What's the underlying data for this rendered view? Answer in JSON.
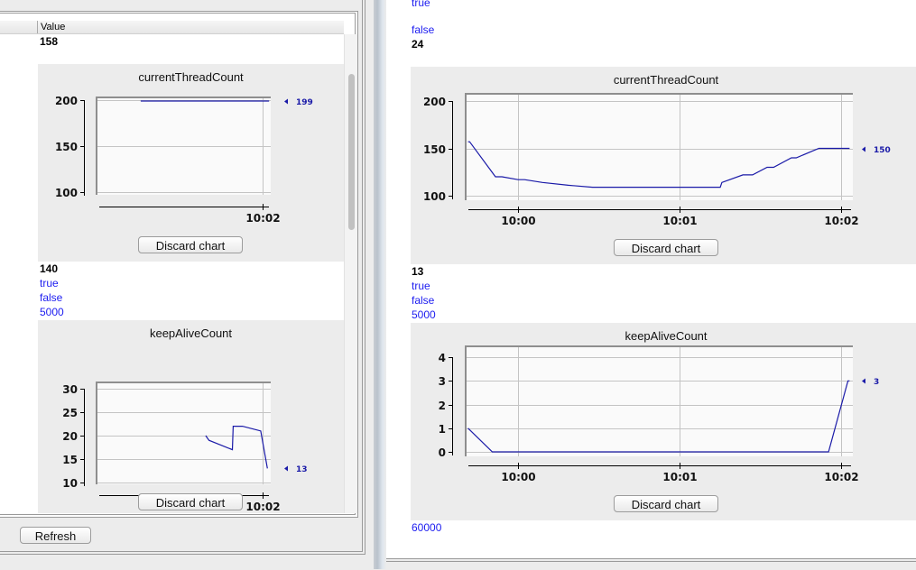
{
  "left_panel": {
    "table_header": {
      "value_column": "Value"
    },
    "rows_top": [
      {
        "text": "158",
        "style": "black"
      }
    ],
    "chart1": {
      "title": "currentThreadCount",
      "discard_label": "Discard chart",
      "last_value_label": "199"
    },
    "rows_mid": [
      {
        "text": "140",
        "style": "black"
      },
      {
        "text": "true",
        "style": "blue"
      },
      {
        "text": "false",
        "style": "blue"
      },
      {
        "text": "5000",
        "style": "blue"
      }
    ],
    "chart2": {
      "title": "keepAliveCount",
      "discard_label": "Discard chart",
      "last_value_label": "13"
    },
    "refresh_label": "Refresh"
  },
  "right_panel": {
    "rows_top": [
      {
        "text": "true",
        "style": "blue"
      },
      {
        "text": "false",
        "style": "blue"
      },
      {
        "text": "24",
        "style": "black"
      }
    ],
    "chart1": {
      "title": "currentThreadCount",
      "discard_label": "Discard chart",
      "last_value_label": "150"
    },
    "rows_mid": [
      {
        "text": "13",
        "style": "black"
      },
      {
        "text": "true",
        "style": "blue"
      },
      {
        "text": "false",
        "style": "blue"
      },
      {
        "text": "5000",
        "style": "blue"
      }
    ],
    "chart2": {
      "title": "keepAliveCount",
      "discard_label": "Discard chart",
      "last_value_label": "3"
    },
    "rows_bottom": [
      {
        "text": "60000",
        "style": "blue"
      }
    ]
  },
  "colors": {
    "series": "#1a1aa8",
    "blue_text": "#1c1cf0",
    "panel_bg": "#ececec",
    "plot_bg": "#fafafa",
    "grid": "#c4c4c4"
  },
  "chart_data": [
    {
      "id": "left-currentThreadCount",
      "type": "line",
      "title": "currentThreadCount",
      "xlabel": "",
      "ylabel": "",
      "x_unit": "minutes after 10:00",
      "xlim": [
        1.0,
        2.05
      ],
      "ylim": [
        100,
        200
      ],
      "yticks": [
        100,
        150,
        200
      ],
      "xticks": [
        {
          "v": 2,
          "label": "10:02"
        }
      ],
      "grid": true,
      "series": [
        {
          "name": "currentThreadCount",
          "x": [
            1.27,
            2.04
          ],
          "y": [
            199,
            199
          ]
        }
      ],
      "last_value": 199
    },
    {
      "id": "left-keepAliveCount",
      "type": "line",
      "title": "keepAliveCount",
      "xlabel": "",
      "ylabel": "",
      "x_unit": "minutes after 10:00",
      "xlim": [
        1.0,
        2.05
      ],
      "ylim": [
        10,
        30
      ],
      "yticks": [
        10,
        15,
        20,
        25,
        30
      ],
      "xticks": [
        {
          "v": 2,
          "label": "10:02"
        }
      ],
      "grid": true,
      "series": [
        {
          "name": "keepAliveCount",
          "x": [
            1.66,
            1.68,
            1.82,
            1.825,
            1.88,
            1.99,
            2.03
          ],
          "y": [
            20,
            19,
            17,
            22,
            22,
            21,
            13
          ]
        }
      ],
      "last_value": 13
    },
    {
      "id": "right-currentThreadCount",
      "type": "line",
      "title": "currentThreadCount",
      "xlabel": "",
      "ylabel": "",
      "x_unit": "minutes after 10:00",
      "xlim": [
        -0.33,
        2.07
      ],
      "ylim": [
        100,
        200
      ],
      "yticks": [
        100,
        150,
        200
      ],
      "xticks": [
        {
          "v": 0,
          "label": "10:00"
        },
        {
          "v": 1,
          "label": "10:01"
        },
        {
          "v": 2,
          "label": "10:02"
        }
      ],
      "grid": true,
      "series": [
        {
          "name": "currentThreadCount",
          "x": [
            -0.31,
            -0.3,
            -0.14,
            -0.1,
            0.0,
            0.04,
            0.15,
            0.31,
            0.46,
            1.25,
            1.26,
            1.39,
            1.45,
            1.54,
            1.58,
            1.69,
            1.72,
            1.86,
            2.05
          ],
          "y": [
            157,
            157,
            120,
            120,
            117,
            117,
            114,
            111,
            109,
            109,
            114,
            122,
            122,
            130,
            130,
            140,
            140,
            150,
            150
          ]
        }
      ],
      "last_value": 150
    },
    {
      "id": "right-keepAliveCount",
      "type": "line",
      "title": "keepAliveCount",
      "xlabel": "",
      "ylabel": "",
      "x_unit": "minutes after 10:00",
      "xlim": [
        -0.33,
        2.07
      ],
      "ylim": [
        0,
        4
      ],
      "yticks": [
        0,
        1,
        2,
        3,
        4
      ],
      "xticks": [
        {
          "v": 0,
          "label": "10:00"
        },
        {
          "v": 1,
          "label": "10:01"
        },
        {
          "v": 2,
          "label": "10:02"
        }
      ],
      "grid": true,
      "series": [
        {
          "name": "keepAliveCount",
          "x": [
            -0.31,
            -0.16,
            1.92,
            2.04,
            2.05
          ],
          "y": [
            1,
            0,
            0,
            3,
            3
          ]
        }
      ],
      "last_value": 3
    }
  ]
}
